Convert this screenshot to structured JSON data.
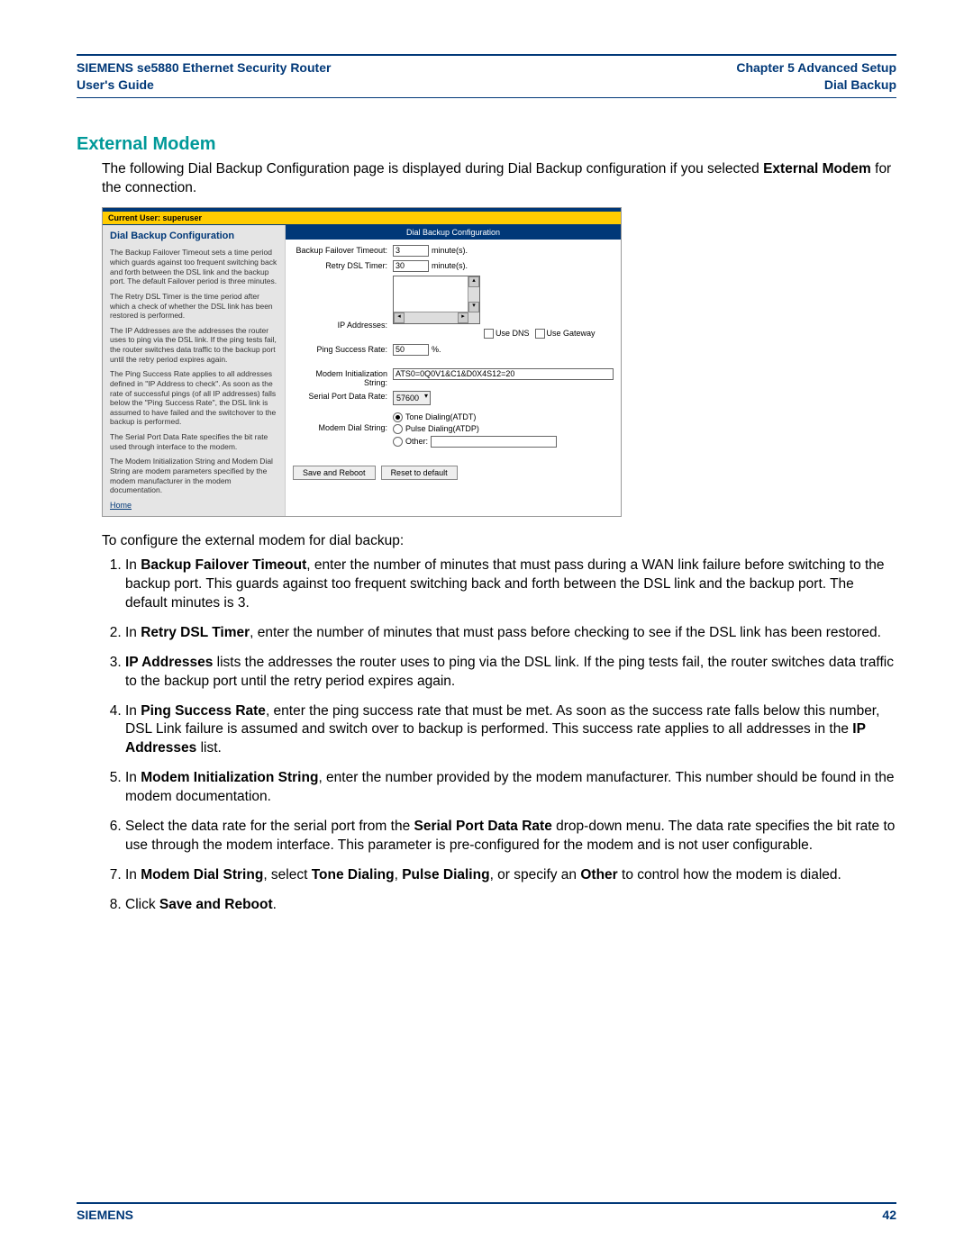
{
  "header": {
    "left_line1": "SIEMENS se5880 Ethernet Security Router",
    "left_line2": "User's Guide",
    "right_line1": "Chapter 5  Advanced Setup",
    "right_line2": "Dial Backup"
  },
  "section_title": "External Modem",
  "intro_pre": "The following Dial Backup Configuration page is displayed during Dial Backup configuration if you selected ",
  "intro_bold": "External Modem",
  "intro_post": " for the connection.",
  "panel": {
    "current_user": "Current User: superuser",
    "left_title": "Dial Backup Configuration",
    "left_p1": "The Backup Failover Timeout sets a time period which guards against too frequent switching back and forth between the DSL link and the backup port. The default Failover period is three minutes.",
    "left_p2": "The Retry DSL Timer is the time period after which a check of whether the DSL link has been restored is performed.",
    "left_p3": "The IP Addresses are the addresses the router uses to ping via the DSL link. If the ping tests fail, the router switches data traffic to the backup port until the retry period expires again.",
    "left_p4": "The Ping Success Rate applies to all addresses defined in \"IP Address to check\". As soon as the rate of successful pings (of all IP addresses) falls below the \"Ping Success Rate\", the DSL link is assumed to have failed and the switchover to the backup is performed.",
    "left_p5": "The Serial Port Data Rate specifies the bit rate used through interface to the modem.",
    "left_p6": "The Modem Initialization String and Modem Dial String are modem parameters specified by the modem manufacturer in the modem documentation.",
    "home": "Home",
    "right_title": "Dial Backup Configuration",
    "lbl_failover": "Backup Failover Timeout:",
    "val_failover": "3",
    "unit_minutes": "minute(s).",
    "lbl_retry": "Retry DSL Timer:",
    "val_retry": "30",
    "lbl_ip": "IP Addresses:",
    "chk_usedns": "Use DNS",
    "chk_usegw": "Use Gateway",
    "lbl_ping": "Ping Success Rate:",
    "val_ping": "50",
    "unit_pct": "%.",
    "lbl_modeminit": "Modem Initialization String:",
    "val_modeminit": "ATS0=0Q0V1&C1&D0X4S12=20",
    "lbl_serial": "Serial Port Data Rate:",
    "val_serial": "57600",
    "lbl_dial": "Modem Dial String:",
    "radio_tone": "Tone Dialing(ATDT)",
    "radio_pulse": "Pulse Dialing(ATDP)",
    "radio_other": "Other:",
    "btn_save": "Save and Reboot",
    "btn_reset": "Reset to default"
  },
  "configure_text": "To configure the external modem for dial backup:",
  "steps": {
    "s1_pre": "In ",
    "s1_b": "Backup Failover Timeout",
    "s1_post": ", enter the number of minutes that must pass during a WAN link failure before switching to the backup port. This guards against too frequent switching back and forth between the DSL link and the backup port. The default minutes is 3.",
    "s2_pre": "In ",
    "s2_b": "Retry DSL Timer",
    "s2_post": ", enter the number of minutes that must pass before checking to see if the DSL link has been restored.",
    "s3_b": "IP Addresses",
    "s3_post": " lists the addresses the router uses to ping via the DSL link. If the ping tests fail, the router switches data traffic to the backup port until the retry period expires again.",
    "s4_pre": "In ",
    "s4_b": "Ping Success Rate",
    "s4_mid": ", enter the ping success rate that must be met. As soon as the success rate falls below this number, DSL Link failure is assumed and switch over to backup is performed. This success rate applies to all addresses in the ",
    "s4_b2": "IP Addresses",
    "s4_post": " list.",
    "s5_pre": "In ",
    "s5_b": "Modem Initialization String",
    "s5_post": ", enter the number provided by the modem manufacturer. This number should be found in the modem documentation.",
    "s6_pre": "Select the data rate for the serial port from the ",
    "s6_b": "Serial Port Data Rate",
    "s6_post": " drop-down menu. The data rate specifies the bit rate to use through the modem interface. This parameter is pre-configured for the modem and is not user configurable.",
    "s7_pre": "In ",
    "s7_b": "Modem Dial String",
    "s7_mid1": ", select ",
    "s7_b2": "Tone Dialing",
    "s7_mid2": ", ",
    "s7_b3": "Pulse Dialing",
    "s7_mid3": ", or specify an ",
    "s7_b4": "Other",
    "s7_post": " to control how the modem is dialed.",
    "s8_pre": "Click ",
    "s8_b": "Save and Reboot",
    "s8_post": "."
  },
  "footer": {
    "brand": "SIEMENS",
    "page": "42"
  }
}
